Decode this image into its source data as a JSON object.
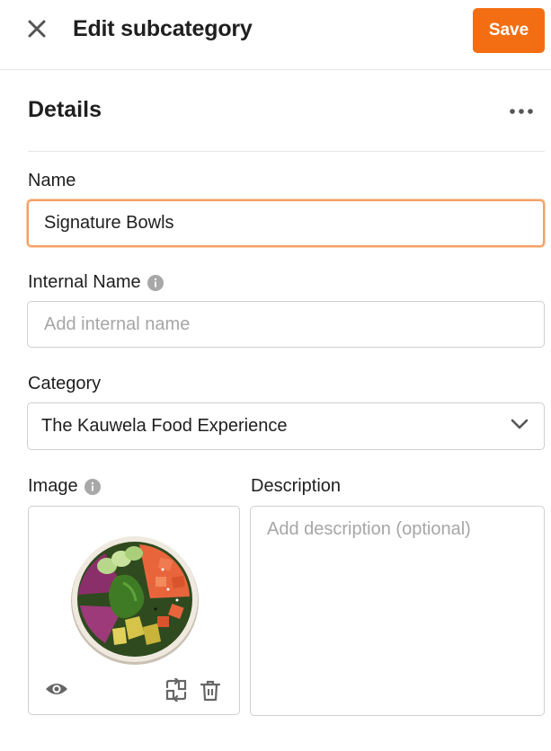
{
  "header": {
    "title": "Edit subcategory",
    "save_label": "Save",
    "close_icon": "close-icon",
    "accent_color": "#f36e13"
  },
  "details": {
    "section_title": "Details",
    "more_icon": "more-horizontal-icon"
  },
  "fields": {
    "name": {
      "label": "Name",
      "value": "Signature Bowls"
    },
    "internal_name": {
      "label": "Internal Name",
      "placeholder": "Add internal name",
      "info_icon": "info-icon"
    },
    "category": {
      "label": "Category",
      "selected": "The Kauwela Food Experience",
      "icon": "chevron-down-icon"
    },
    "image": {
      "label": "Image",
      "info_icon": "info-icon",
      "actions": [
        "eye-icon",
        "replace-icon",
        "trash-icon"
      ]
    },
    "description": {
      "label": "Description",
      "placeholder": "Add description (optional)"
    }
  }
}
